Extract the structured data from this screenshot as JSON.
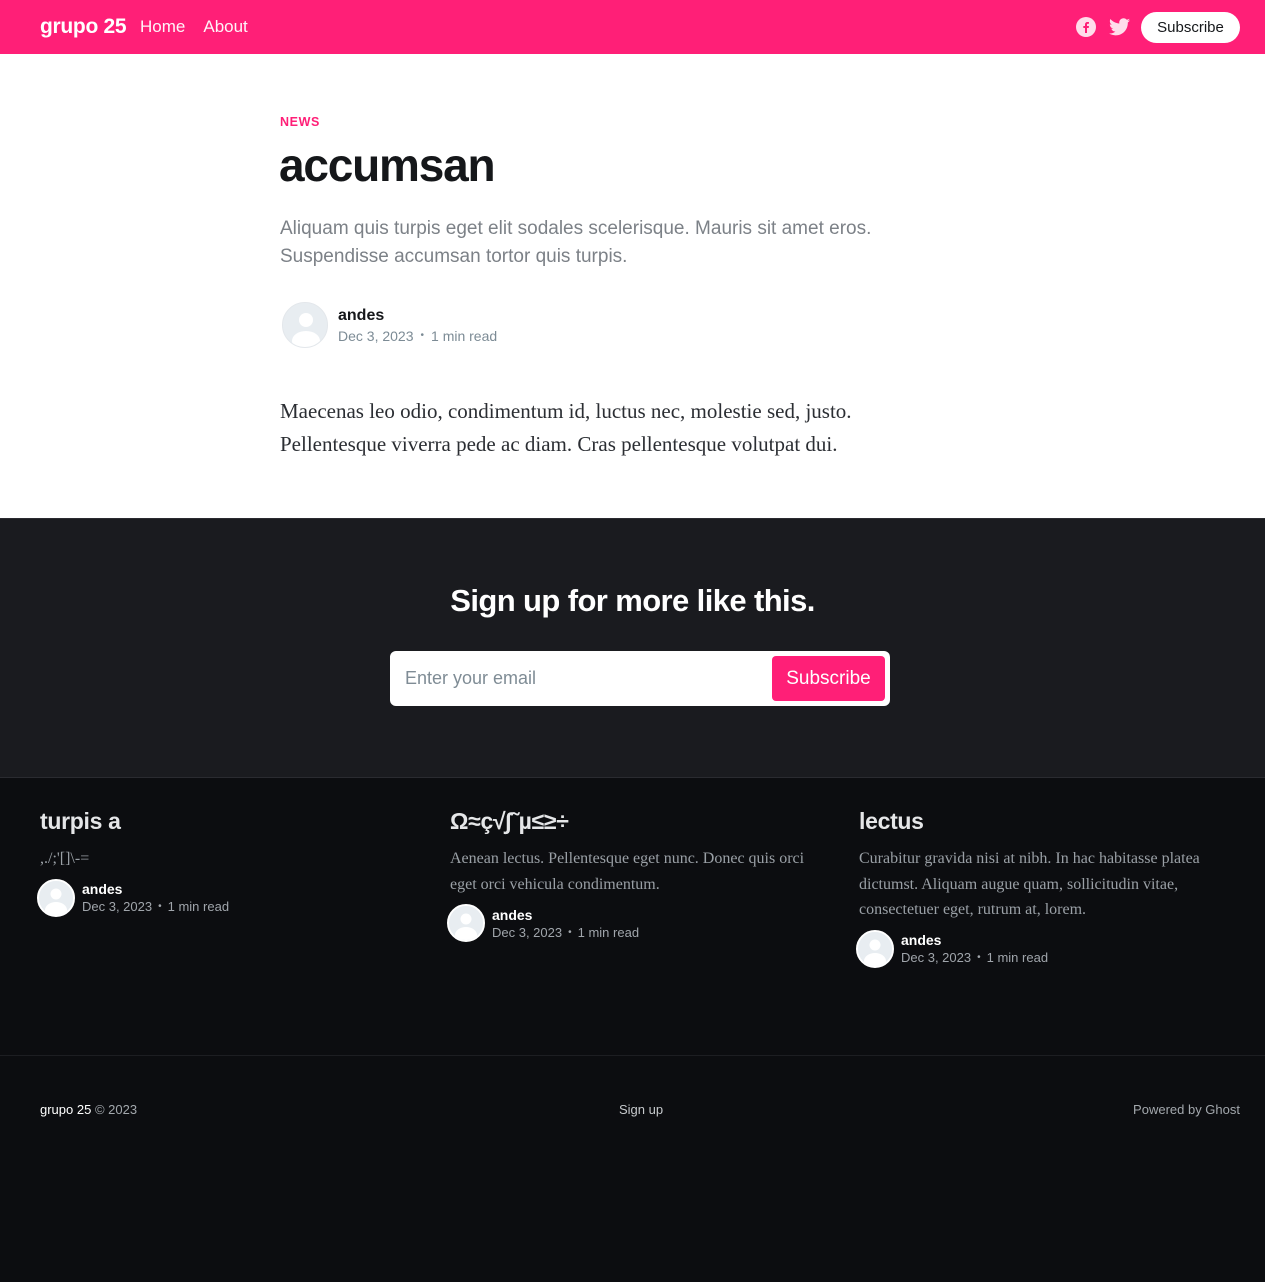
{
  "header": {
    "site_name": "grupo 25",
    "nav": [
      "Home",
      "About"
    ],
    "social": [
      "facebook-icon",
      "twitter-icon"
    ],
    "subscribe_label": "Subscribe",
    "accent": "#ff1f77"
  },
  "article": {
    "tag": "NEWS",
    "title": "accumsan",
    "excerpt": "Aliquam quis turpis eget elit sodales scelerisque. Mauris sit amet eros. Suspendisse accumsan tortor quis turpis.",
    "author": "andes",
    "date": "Dec 3, 2023",
    "reading_time": "1 min read",
    "body": "Maecenas leo odio, condimentum id, luctus nec, molestie sed, justo. Pellentesque viverra pede ac diam. Cras pellentesque volutpat dui."
  },
  "signup": {
    "title": "Sign up for more like this.",
    "placeholder": "Enter your email",
    "button": "Subscribe"
  },
  "related": [
    {
      "title": "turpis a",
      "excerpt": ",./;'[]\\-=",
      "author": "andes",
      "date": "Dec 3, 2023",
      "reading_time": "1 min read"
    },
    {
      "title": "Ω≈ç√∫˜µ≤≥÷",
      "excerpt": "Aenean lectus. Pellentesque eget nunc. Donec quis orci eget orci vehicula condimentum.",
      "author": "andes",
      "date": "Dec 3, 2023",
      "reading_time": "1 min read"
    },
    {
      "title": "lectus",
      "excerpt": "Curabitur gravida nisi at nibh. In hac habitasse platea dictumst. Aliquam augue quam, sollicitudin vitae, consectetuer eget, rutrum at, lorem.",
      "author": "andes",
      "date": "Dec 3, 2023",
      "reading_time": "1 min read"
    }
  ],
  "footer": {
    "site_name": "grupo 25",
    "copyright": "© 2023",
    "signup": "Sign up",
    "powered": "Powered by Ghost"
  }
}
